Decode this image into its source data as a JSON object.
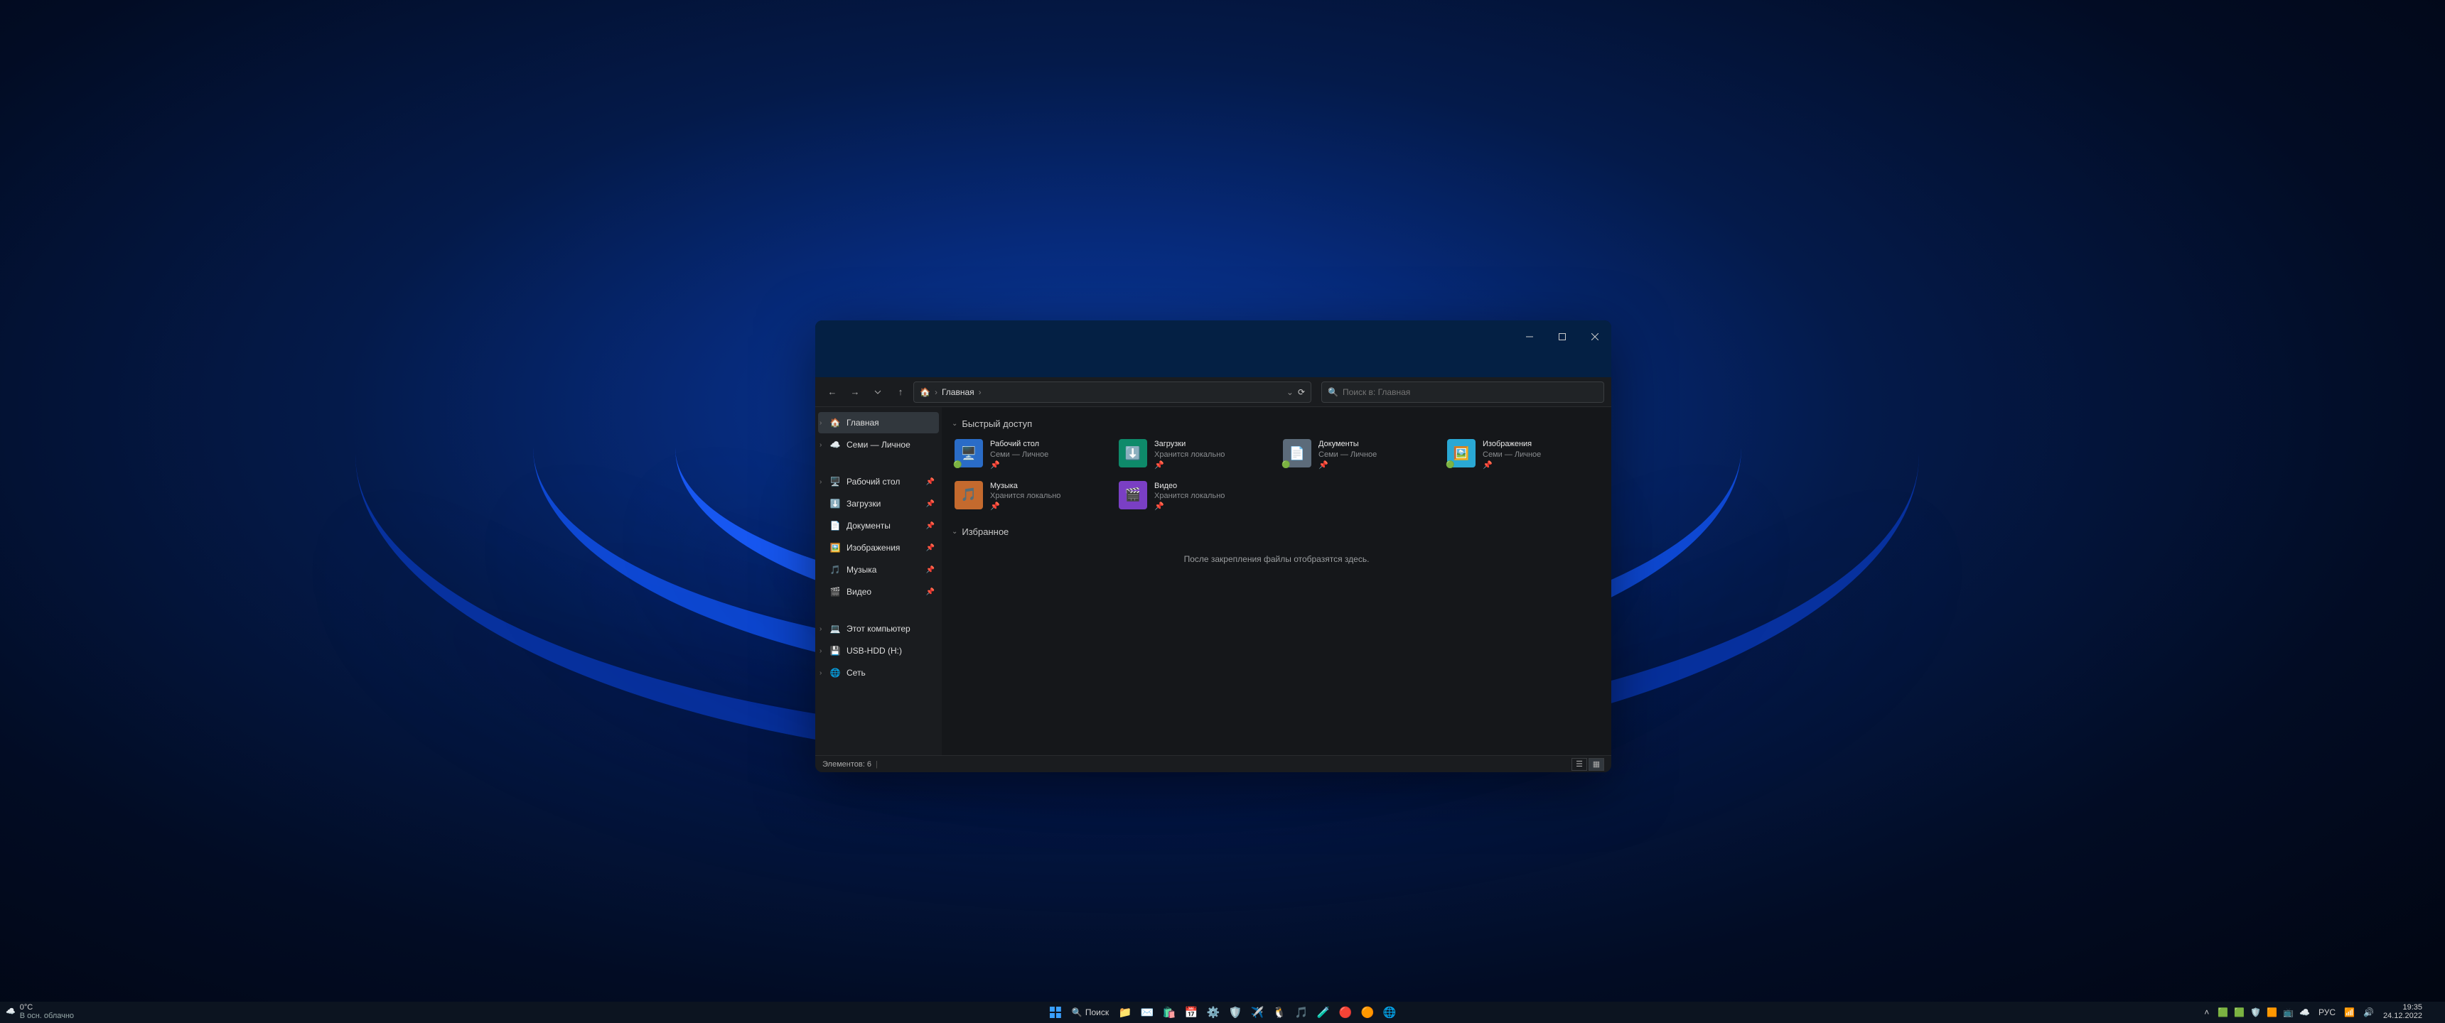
{
  "colors": {
    "accent": "#0a45d6"
  },
  "weather": {
    "temp": "0°C",
    "desc": "В осн. облачно"
  },
  "explorer": {
    "breadcrumb": {
      "root_icon": "home",
      "current": "Главная"
    },
    "search_placeholder": "Поиск в: Главная",
    "sidebar": [
      {
        "icon": "home",
        "label": "Главная",
        "active": true,
        "expandable": true
      },
      {
        "icon": "onedrive",
        "label": "Семи — Личное",
        "expandable": true
      },
      {
        "spacer": true
      },
      {
        "icon": "desktop",
        "label": "Рабочий стол",
        "pinned": true,
        "expandable": true
      },
      {
        "icon": "download",
        "label": "Загрузки",
        "pinned": true
      },
      {
        "icon": "document",
        "label": "Документы",
        "pinned": true
      },
      {
        "icon": "picture",
        "label": "Изображения",
        "pinned": true
      },
      {
        "icon": "music",
        "label": "Музыка",
        "pinned": true
      },
      {
        "icon": "video",
        "label": "Видео",
        "pinned": true
      },
      {
        "spacer": true
      },
      {
        "icon": "pc",
        "label": "Этот компьютер",
        "expandable": true
      },
      {
        "icon": "usb",
        "label": "USB-HDD (H:)",
        "expandable": true
      },
      {
        "icon": "network",
        "label": "Сеть",
        "expandable": true
      }
    ],
    "groups": {
      "quick_access": {
        "title": "Быстрый доступ",
        "items": [
          {
            "icon": "desktop",
            "bg": "#2a6cc7",
            "name": "Рабочий стол",
            "loc": "Семи — Личное",
            "sync": true
          },
          {
            "icon": "download",
            "bg": "#0e8a6a",
            "name": "Загрузки",
            "loc": "Хранится локально"
          },
          {
            "icon": "document",
            "bg": "#5c6b7a",
            "name": "Документы",
            "loc": "Семи — Личное",
            "sync": true
          },
          {
            "icon": "picture",
            "bg": "#2aa8d4",
            "name": "Изображения",
            "loc": "Семи — Личное",
            "sync": true
          },
          {
            "icon": "music",
            "bg": "#c46a2e",
            "name": "Музыка",
            "loc": "Хранится локально"
          },
          {
            "icon": "video",
            "bg": "#7a3fc4",
            "name": "Видео",
            "loc": "Хранится локально"
          }
        ]
      },
      "favorites": {
        "title": "Избранное",
        "empty_text": "После закрепления файлы отобразятся здесь."
      }
    },
    "status": {
      "count_label": "Элементов:",
      "count": "6"
    }
  },
  "taskbar": {
    "search_label": "Поиск",
    "center_icons": [
      "start",
      "search",
      "explorer",
      "mail",
      "store",
      "calendar",
      "settings",
      "security",
      "telegram",
      "tux",
      "tiktok",
      "beaker",
      "opera-gx",
      "opera",
      "edge"
    ],
    "tray_icons": [
      "chevron-up",
      "nvidia",
      "antivirus-k",
      "shield",
      "antivirus-o",
      "cast",
      "onedrive"
    ],
    "lang": "РУС",
    "time": "19:35",
    "date": "24.12.2022"
  }
}
